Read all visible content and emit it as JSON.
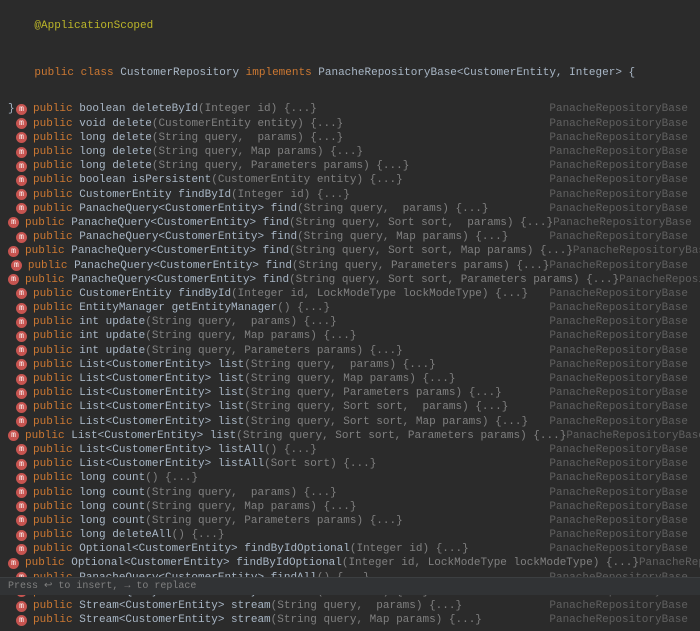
{
  "header": {
    "annotation": "@ApplicationScoped",
    "signature_pre": "public class ",
    "class_name": "CustomerRepository",
    "implements_kw": " implements ",
    "iface": "PanacheRepositoryBase<CustomerEntity, Integer> {"
  },
  "closing_brace": "}",
  "source_label": "PanacheRepositoryBase",
  "statusbar_text": "Press ↩ to insert, → to replace",
  "methods": [
    {
      "modifier": "public ",
      "ret": "boolean ",
      "name": "deleteById",
      "params": "(Integer id)",
      "fold": " {...}"
    },
    {
      "modifier": "public ",
      "ret": "void ",
      "name": "delete",
      "params": "(CustomerEntity entity)",
      "fold": " {...}"
    },
    {
      "modifier": "public ",
      "ret": "long ",
      "name": "delete",
      "params": "(String query,  params)",
      "fold": " {...}"
    },
    {
      "modifier": "public ",
      "ret": "long ",
      "name": "delete",
      "params": "(String query, Map params)",
      "fold": " {...}"
    },
    {
      "modifier": "public ",
      "ret": "long ",
      "name": "delete",
      "params": "(String query, Parameters params)",
      "fold": " {...}"
    },
    {
      "modifier": "public ",
      "ret": "boolean ",
      "name": "isPersistent",
      "params": "(CustomerEntity entity)",
      "fold": " {...}"
    },
    {
      "modifier": "public ",
      "ret": "CustomerEntity ",
      "name": "findById",
      "params": "(Integer id)",
      "fold": " {...}"
    },
    {
      "modifier": "public ",
      "ret": "PanacheQuery<CustomerEntity> ",
      "name": "find",
      "params": "(String query,  params)",
      "fold": " {...}"
    },
    {
      "modifier": "public ",
      "ret": "PanacheQuery<CustomerEntity> ",
      "name": "find",
      "params": "(String query, Sort sort,  params)",
      "fold": " {...}"
    },
    {
      "modifier": "public ",
      "ret": "PanacheQuery<CustomerEntity> ",
      "name": "find",
      "params": "(String query, Map params)",
      "fold": " {...}"
    },
    {
      "modifier": "public ",
      "ret": "PanacheQuery<CustomerEntity> ",
      "name": "find",
      "params": "(String query, Sort sort, Map params)",
      "fold": " {...}"
    },
    {
      "modifier": "public ",
      "ret": "PanacheQuery<CustomerEntity> ",
      "name": "find",
      "params": "(String query, Parameters params)",
      "fold": " {...}"
    },
    {
      "modifier": "public ",
      "ret": "PanacheQuery<CustomerEntity> ",
      "name": "find",
      "params": "(String query, Sort sort, Parameters params)",
      "fold": " {...}"
    },
    {
      "modifier": "public ",
      "ret": "CustomerEntity ",
      "name": "findById",
      "params": "(Integer id, LockModeType lockModeType)",
      "fold": " {...}"
    },
    {
      "modifier": "public ",
      "ret": "EntityManager ",
      "name": "getEntityManager",
      "params": "()",
      "fold": " {...}"
    },
    {
      "modifier": "public ",
      "ret": "int ",
      "name": "update",
      "params": "(String query,  params)",
      "fold": " {...}"
    },
    {
      "modifier": "public ",
      "ret": "int ",
      "name": "update",
      "params": "(String query, Map params)",
      "fold": " {...}"
    },
    {
      "modifier": "public ",
      "ret": "int ",
      "name": "update",
      "params": "(String query, Parameters params)",
      "fold": " {...}"
    },
    {
      "modifier": "public ",
      "ret": "List<CustomerEntity> ",
      "name": "list",
      "params": "(String query,  params)",
      "fold": " {...}"
    },
    {
      "modifier": "public ",
      "ret": "List<CustomerEntity> ",
      "name": "list",
      "params": "(String query, Map params)",
      "fold": " {...}"
    },
    {
      "modifier": "public ",
      "ret": "List<CustomerEntity> ",
      "name": "list",
      "params": "(String query, Parameters params)",
      "fold": " {...}"
    },
    {
      "modifier": "public ",
      "ret": "List<CustomerEntity> ",
      "name": "list",
      "params": "(String query, Sort sort,  params)",
      "fold": " {...}"
    },
    {
      "modifier": "public ",
      "ret": "List<CustomerEntity> ",
      "name": "list",
      "params": "(String query, Sort sort, Map params)",
      "fold": " {...}"
    },
    {
      "modifier": "public ",
      "ret": "List<CustomerEntity> ",
      "name": "list",
      "params": "(String query, Sort sort, Parameters params)",
      "fold": " {...}"
    },
    {
      "modifier": "public ",
      "ret": "List<CustomerEntity> ",
      "name": "listAll",
      "params": "()",
      "fold": " {...}"
    },
    {
      "modifier": "public ",
      "ret": "List<CustomerEntity> ",
      "name": "listAll",
      "params": "(Sort sort)",
      "fold": " {...}"
    },
    {
      "modifier": "public ",
      "ret": "long ",
      "name": "count",
      "params": "()",
      "fold": " {...}"
    },
    {
      "modifier": "public ",
      "ret": "long ",
      "name": "count",
      "params": "(String query,  params)",
      "fold": " {...}"
    },
    {
      "modifier": "public ",
      "ret": "long ",
      "name": "count",
      "params": "(String query, Map params)",
      "fold": " {...}"
    },
    {
      "modifier": "public ",
      "ret": "long ",
      "name": "count",
      "params": "(String query, Parameters params)",
      "fold": " {...}"
    },
    {
      "modifier": "public ",
      "ret": "long ",
      "name": "deleteAll",
      "params": "()",
      "fold": " {...}"
    },
    {
      "modifier": "public ",
      "ret": "Optional<CustomerEntity> ",
      "name": "findByIdOptional",
      "params": "(Integer id)",
      "fold": " {...}"
    },
    {
      "modifier": "public ",
      "ret": "Optional<CustomerEntity> ",
      "name": "findByIdOptional",
      "params": "(Integer id, LockModeType lockModeType)",
      "fold": " {...}"
    },
    {
      "modifier": "public ",
      "ret": "PanacheQuery<CustomerEntity> ",
      "name": "findAll",
      "params": "()",
      "fold": " {...}"
    },
    {
      "modifier": "public ",
      "ret": "PanacheQuery<CustomerEntity> ",
      "name": "findAll",
      "params": "(Sort sort)",
      "fold": " {...}"
    },
    {
      "modifier": "public ",
      "ret": "Stream<CustomerEntity> ",
      "name": "stream",
      "params": "(String query,  params)",
      "fold": " {...}"
    },
    {
      "modifier": "public ",
      "ret": "Stream<CustomerEntity> ",
      "name": "stream",
      "params": "(String query, Map params)",
      "fold": " {...}"
    }
  ]
}
